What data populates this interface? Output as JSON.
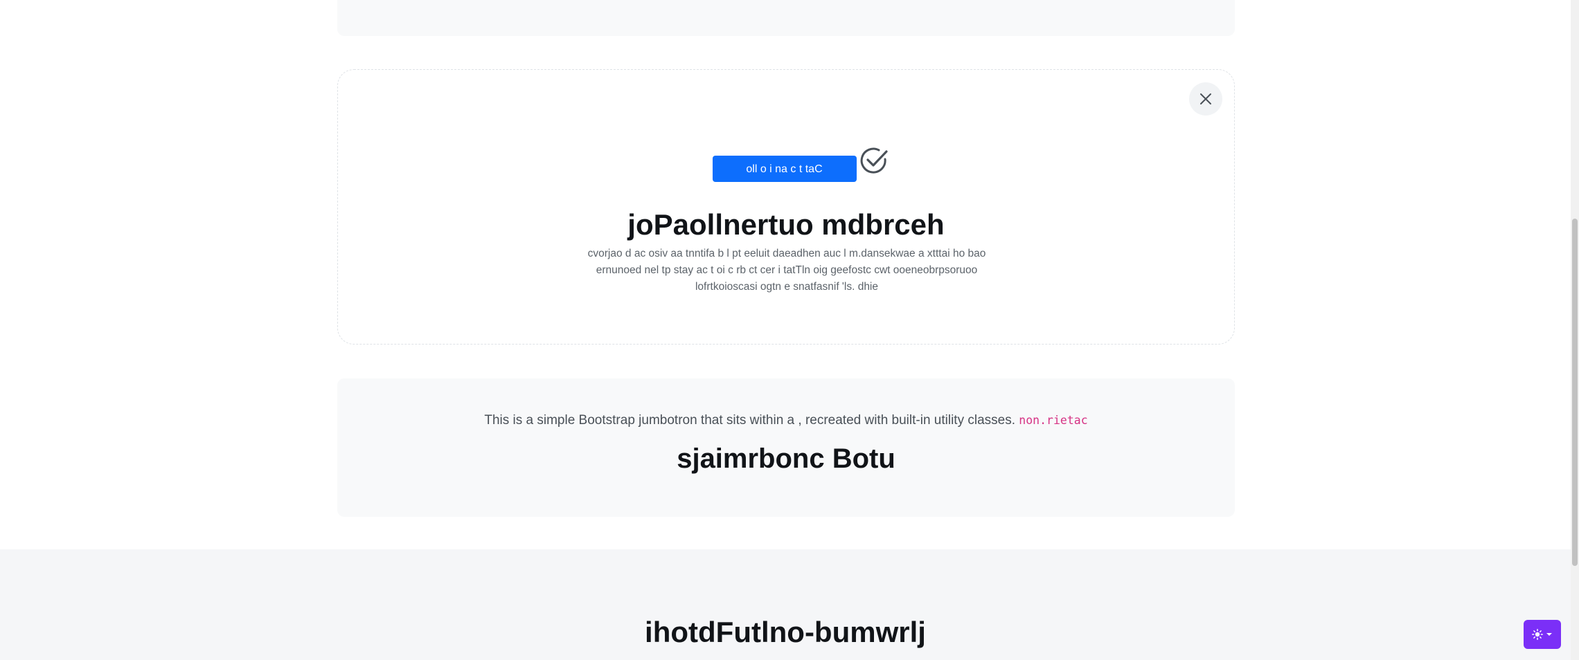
{
  "modal": {
    "cta_label": "oll o i na c t taC",
    "title": "joPaollnertuo mdbrceh",
    "body": "cvorjao d ac osiv aa tnntifa b l pt eeluit daeadhen auc l m.dansekwae a xtttai ho bao ernunoed nel tp stay ac t oi c rb ct cer i tatTln oig geefostc cwt ooeneobrpsoruoo lofrtkoioscasi ogtn e snatfasnif 'ls. dhie",
    "close_icon": "close-icon",
    "check_icon": "check-circle-icon"
  },
  "jumbotron": {
    "text": "This is a simple Bootstrap jumbotron that sits within a , recreated with built-in utility classes.",
    "code": "non.rietac",
    "title": "sjaimrbonc Botu"
  },
  "footer_section": {
    "title": "ihotdFutlno-bumwrlj"
  },
  "theme_toggle": {
    "icon": "sun-icon",
    "caret_icon": "caret-down-icon",
    "color": "#7b2ff7"
  },
  "colors": {
    "primary": "#0d6efd",
    "code": "#d63384",
    "light_bg": "#f8f9fa"
  }
}
